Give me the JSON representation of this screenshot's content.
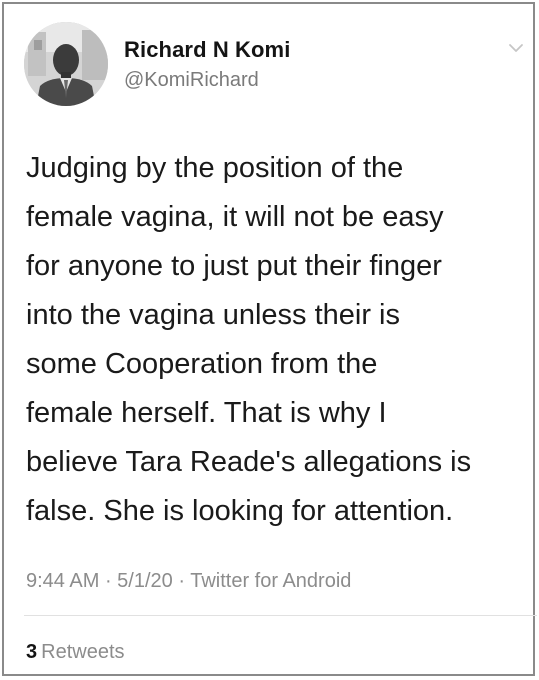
{
  "author": {
    "display_name": "Richard N Komi",
    "handle": "@KomiRichard",
    "avatar_icon": "profile-photo"
  },
  "menu_icon": "chevron-down-icon",
  "tweet": {
    "lines": [
      "Judging by the position of the",
      "female vagina, it will not be easy",
      "for anyone to just put their finger",
      "into the vagina unless their is",
      "some Cooperation from the",
      "female herself. That is why I",
      "believe Tara Reade's allegations is",
      "false. She is looking for attention."
    ]
  },
  "meta": {
    "time": "9:44 AM",
    "date": "5/1/20",
    "source": "Twitter for Android"
  },
  "stats": {
    "retweet_count": "3",
    "retweet_label": "Retweets"
  },
  "colors": {
    "text": "#1a1a1a",
    "secondary": "#8c8c8c",
    "border": "#8a8a8a"
  }
}
